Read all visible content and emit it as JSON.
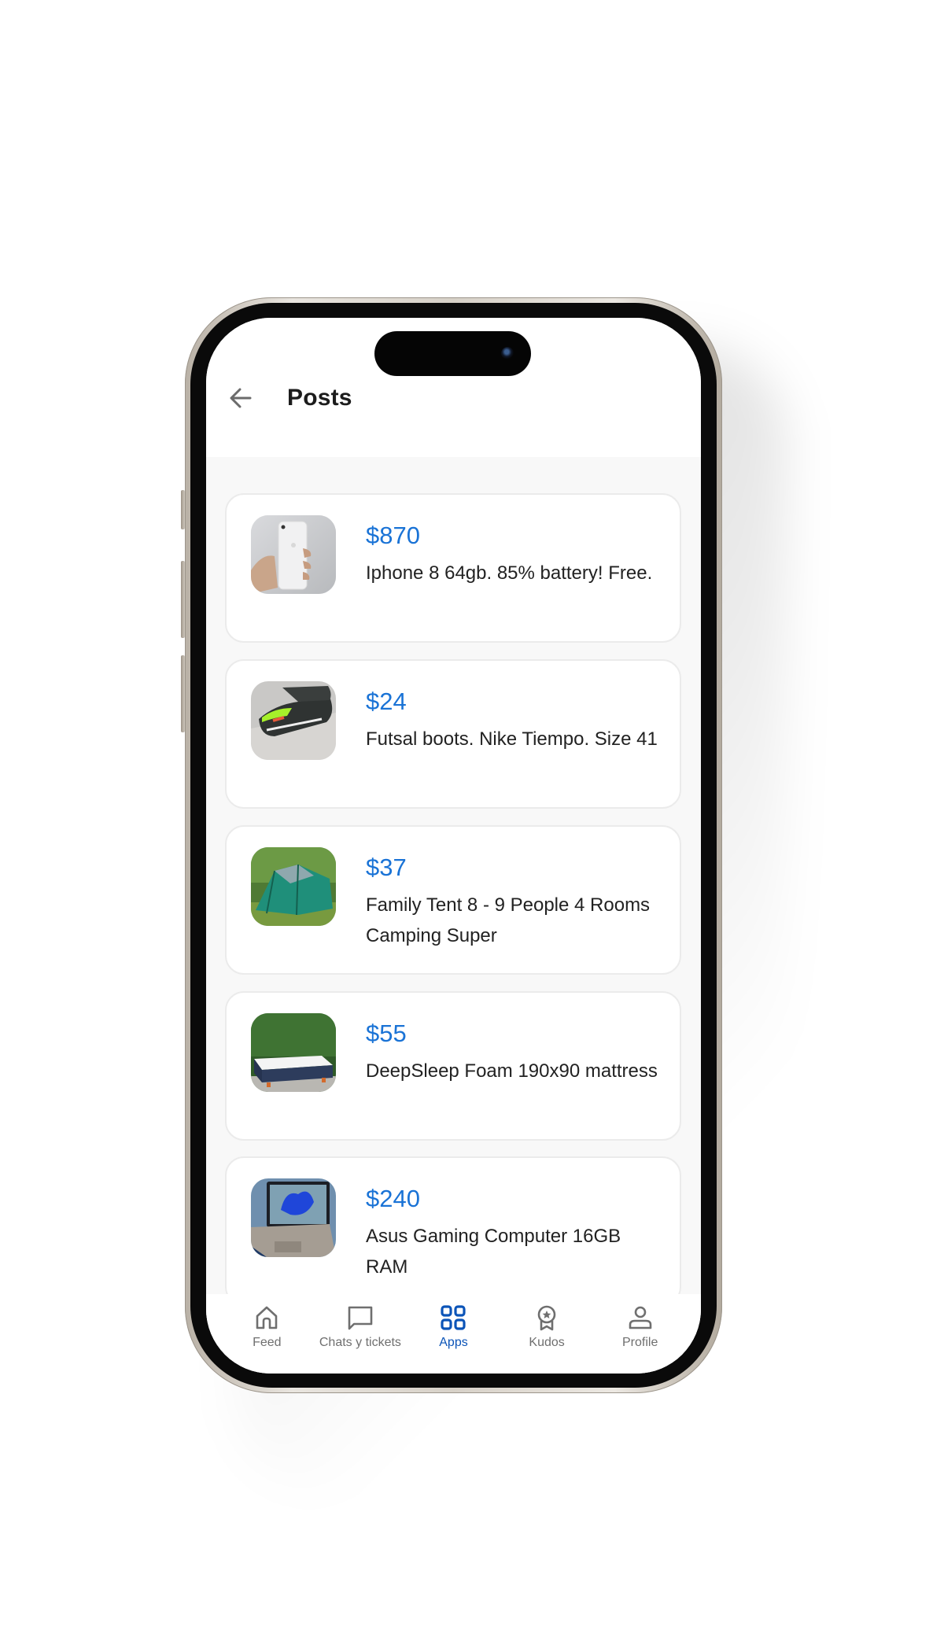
{
  "header": {
    "title": "Posts",
    "back_icon": "arrow-left-icon"
  },
  "posts": [
    {
      "price": "$870",
      "description": "Iphone 8 64gb. 85% battery! Free.",
      "image": "iphone-photo"
    },
    {
      "price": "$24",
      "description": "Futsal boots. Nike Tiempo. Size 41",
      "image": "boots-photo"
    },
    {
      "price": "$37",
      "description": "Family Tent 8 - 9 People 4 Rooms Camping Super",
      "image": "tent-photo"
    },
    {
      "price": "$55",
      "description": "DeepSleep Foam 190x90 mattress",
      "image": "mattress-photo"
    },
    {
      "price": "$240",
      "description": "Asus Gaming Computer 16GB RAM",
      "image": "laptop-photo"
    }
  ],
  "nav": {
    "items": [
      {
        "label": "Feed",
        "icon": "home-icon",
        "active": false
      },
      {
        "label": "Chats y tickets",
        "icon": "chat-icon",
        "active": false
      },
      {
        "label": "Apps",
        "icon": "apps-grid-icon",
        "active": true
      },
      {
        "label": "Kudos",
        "icon": "award-badge-icon",
        "active": false
      },
      {
        "label": "Profile",
        "icon": "user-icon",
        "active": false
      }
    ]
  },
  "colors": {
    "price": "#1a73d6",
    "active_nav": "#0b54b8",
    "inactive_nav": "#6f6f6f",
    "list_background": "#f8f8f8"
  }
}
